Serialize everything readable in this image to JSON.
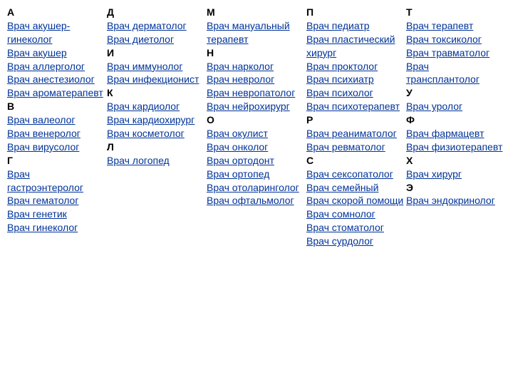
{
  "columns": [
    {
      "groups": [
        {
          "letter": "А",
          "items": [
            "Врач акушер-гинеколог",
            "Врач акушер",
            "Врач аллерголог",
            "Врач анестезиолог",
            "Врач ароматерапевт"
          ]
        },
        {
          "letter": "В",
          "items": [
            "Врач валеолог",
            "Врач венеролог",
            "Врач вирусолог"
          ]
        },
        {
          "letter": "Г",
          "items": [
            "Врач гастроэнтеролог",
            "Врач гематолог",
            "Врач генетик",
            "Врач гинеколог"
          ]
        }
      ]
    },
    {
      "groups": [
        {
          "letter": "Д",
          "items": [
            "Врач дерматолог",
            "Врач диетолог"
          ]
        },
        {
          "letter": "И",
          "items": [
            "Врач иммунолог",
            "Врач инфекционист"
          ]
        },
        {
          "letter": "К",
          "items": [
            "Врач кардиолог",
            "Врач кардиохирург",
            "Врач косметолог"
          ]
        },
        {
          "letter": "Л",
          "items": [
            "Врач логопед"
          ]
        }
      ]
    },
    {
      "groups": [
        {
          "letter": "М",
          "items": [
            "Врач мануальный терапевт"
          ]
        },
        {
          "letter": "Н",
          "items": [
            "Врач нарколог",
            "Врач невролог",
            "Врач невропатолог",
            "Врач нейрохирург"
          ]
        },
        {
          "letter": "О",
          "items": [
            "Врач окулист",
            "Врач онколог",
            "Врач ортодонт",
            "Врач ортопед",
            "Врач отоларинголог",
            "Врач офтальмолог"
          ]
        }
      ]
    },
    {
      "groups": [
        {
          "letter": "П",
          "items": [
            "Врач педиатр",
            "Врач пластический хирург",
            "Врач проктолог",
            "Врач психиатр",
            "Врач психолог",
            "Врач психотерапевт"
          ]
        },
        {
          "letter": "Р",
          "items": [
            "Врач реаниматолог",
            "Врач ревматолог"
          ]
        },
        {
          "letter": "С",
          "items": [
            "Врач сексопатолог",
            "Врач семейный",
            "Врач скорой помощи",
            "Врач сомнолог",
            "Врач стоматолог",
            "Врач сурдолог"
          ]
        }
      ]
    },
    {
      "groups": [
        {
          "letter": "Т",
          "items": [
            "Врач терапевт",
            "Врач токсиколог",
            "Врач травматолог",
            "Врач трансплантолог"
          ]
        },
        {
          "letter": "У",
          "items": [
            "Врач уролог"
          ]
        },
        {
          "letter": "Ф",
          "items": [
            "Врач фармацевт",
            "Врач физиотерапевт"
          ]
        },
        {
          "letter": "Х",
          "items": [
            "Врач хирург"
          ]
        },
        {
          "letter": "Э",
          "items": [
            "Врач эндокринолог"
          ]
        }
      ]
    }
  ]
}
